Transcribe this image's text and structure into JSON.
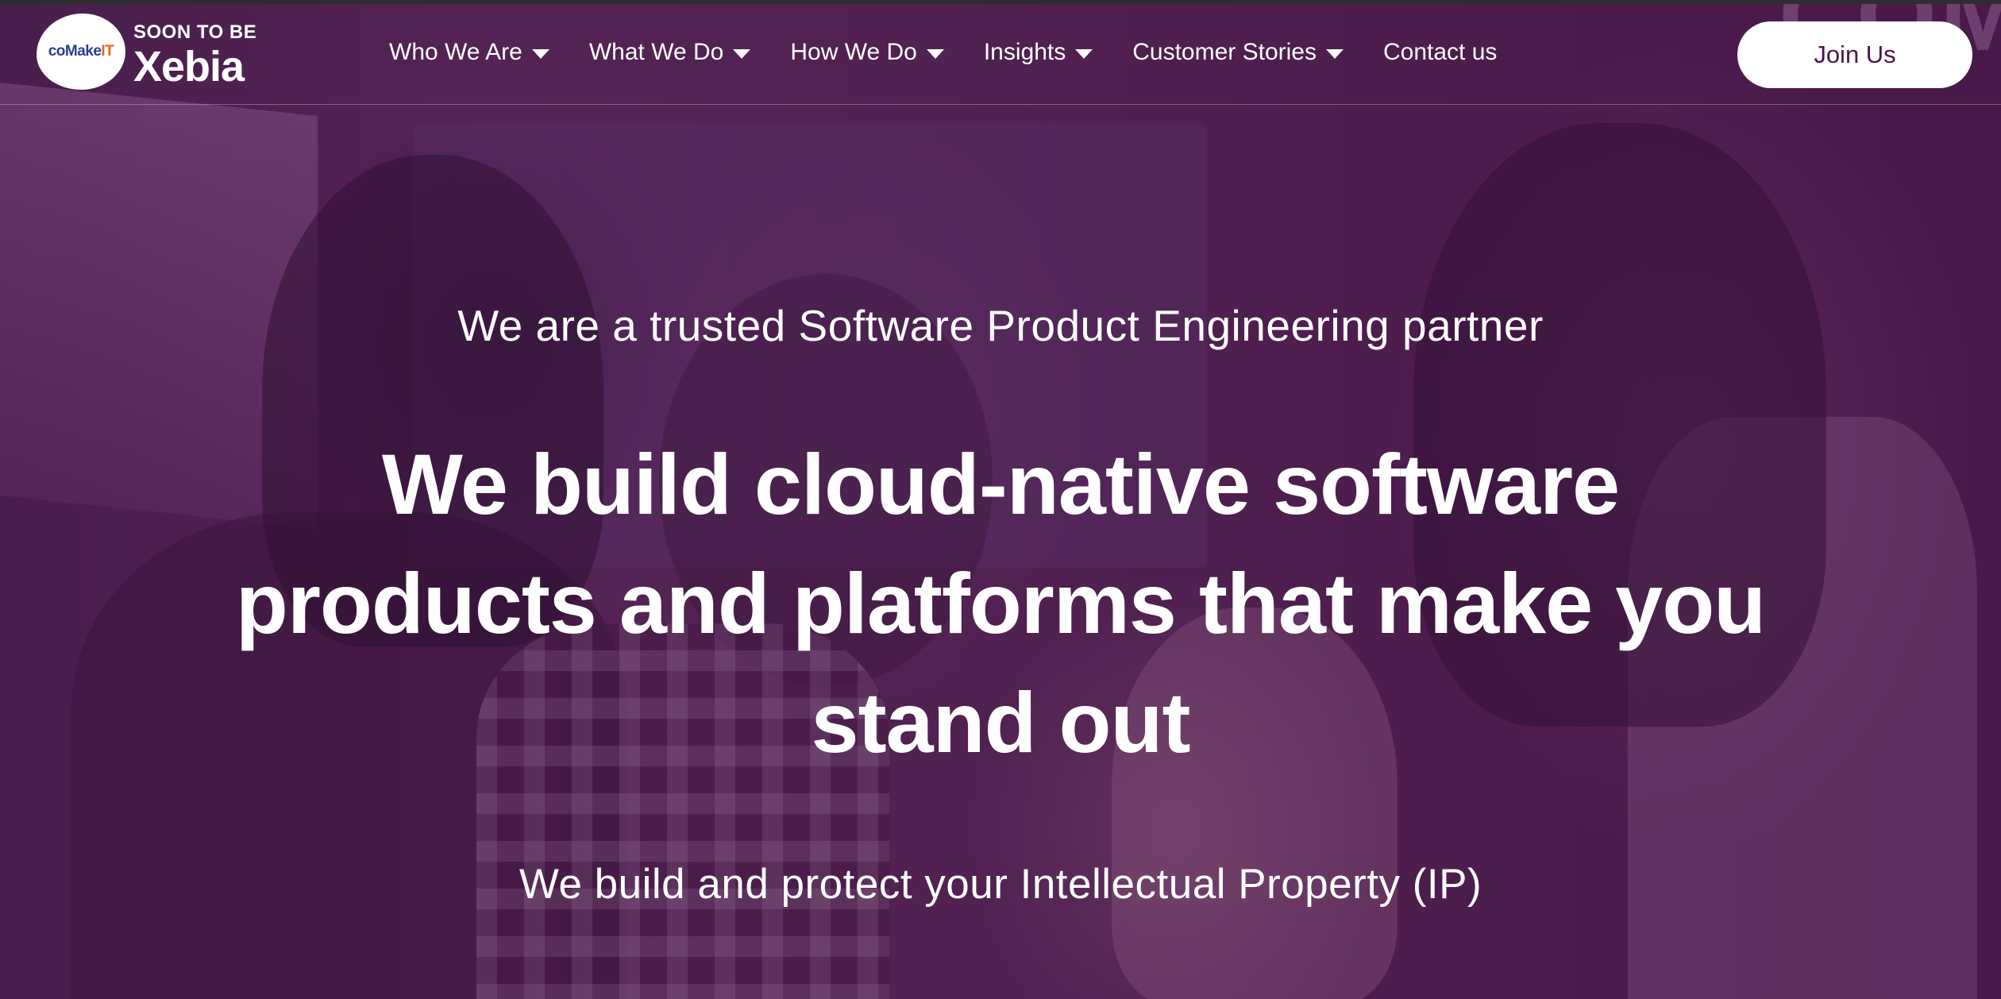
{
  "brand": {
    "logo_mark": "coMake",
    "logo_mark_accent": "IT",
    "tagline_small": "SOON TO BE",
    "tagline_big": "Xebia"
  },
  "nav": {
    "items": [
      {
        "label": "Who We Are",
        "has_dropdown": true
      },
      {
        "label": "What We Do",
        "has_dropdown": true
      },
      {
        "label": "How We Do",
        "has_dropdown": true
      },
      {
        "label": "Insights",
        "has_dropdown": true
      },
      {
        "label": "Customer Stories",
        "has_dropdown": true
      },
      {
        "label": "Contact us",
        "has_dropdown": false
      }
    ],
    "cta_label": "Join Us"
  },
  "hero": {
    "tagline": "We are a trusted Software Product Engineering partner",
    "headline": "We build cloud-native software products and platforms that make you stand out",
    "subline": "We build and protect your Intellectual Property (IP)",
    "background_text": "COM"
  },
  "colors": {
    "overlay": "#48144a",
    "brand_blue": "#2a3f8f",
    "brand_orange": "#e06a1b",
    "button_text": "#4a1450"
  }
}
